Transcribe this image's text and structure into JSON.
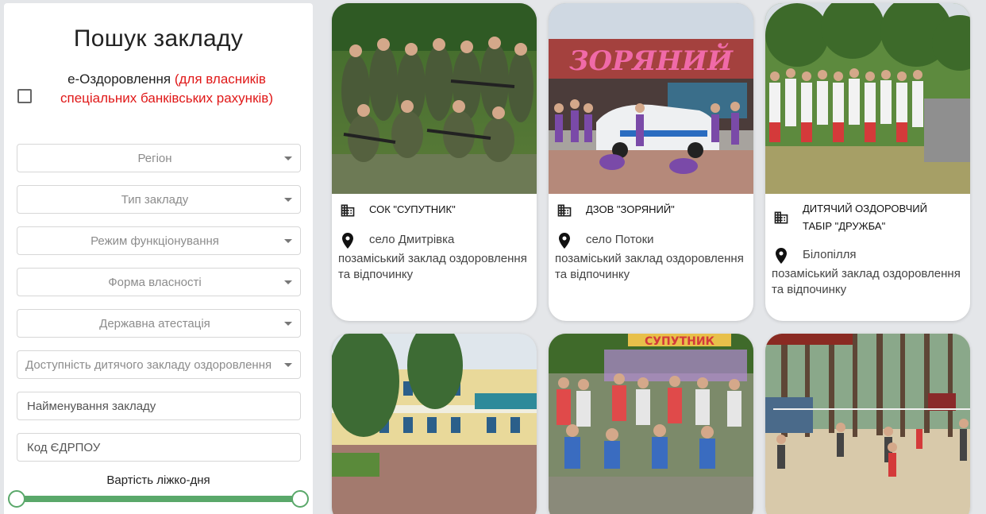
{
  "sidebar": {
    "title": "Пошук закладу",
    "ozd_label": "е-Оздоровлення",
    "ozd_note": "(для власників спеціальних банківських рахунків)",
    "filters": [
      {
        "label": "Регіон"
      },
      {
        "label": "Тип закладу"
      },
      {
        "label": "Режим функціонування"
      },
      {
        "label": "Форма власності"
      },
      {
        "label": "Державна атестація"
      },
      {
        "label": "Доступність дитячого закладу оздоровлення"
      }
    ],
    "name_placeholder": "Найменування закладу",
    "code_placeholder": "Код ЄДРПОУ",
    "price_label": "Вартість ліжко-дня"
  },
  "cards": [
    {
      "name": "СОК \"СУПУТНИК\"",
      "city": "село Дмитрівка",
      "type": "позаміський заклад оздоровлення та відпочинку",
      "photo": "kids-camouflage-photo"
    },
    {
      "name": "ДЗОВ \"ЗОРЯНИЙ\"",
      "city": "село Потоки",
      "type": "позаміський заклад оздоровлення та відпочинку",
      "photo": "zoryanyi-police-car-photo",
      "sign": "ЗОРЯНИЙ"
    },
    {
      "name": "ДИТЯЧИЙ ОЗДОРОВЧИЙ ТАБІР \"ДРУЖБА\"",
      "city": "Білопілля",
      "type": "позаміський заклад оздоровлення та відпочинку",
      "photo": "kids-embroidered-shirts-photo"
    },
    {
      "photo": "building-trees-photo"
    },
    {
      "photo": "group-kids-sign-photo",
      "sign": "СУПУТНИК"
    },
    {
      "photo": "forest-volleyball-photo"
    }
  ],
  "colors": {
    "accent": "#5aa86a",
    "note_red": "#e01818",
    "background": "#e4e6e9"
  }
}
